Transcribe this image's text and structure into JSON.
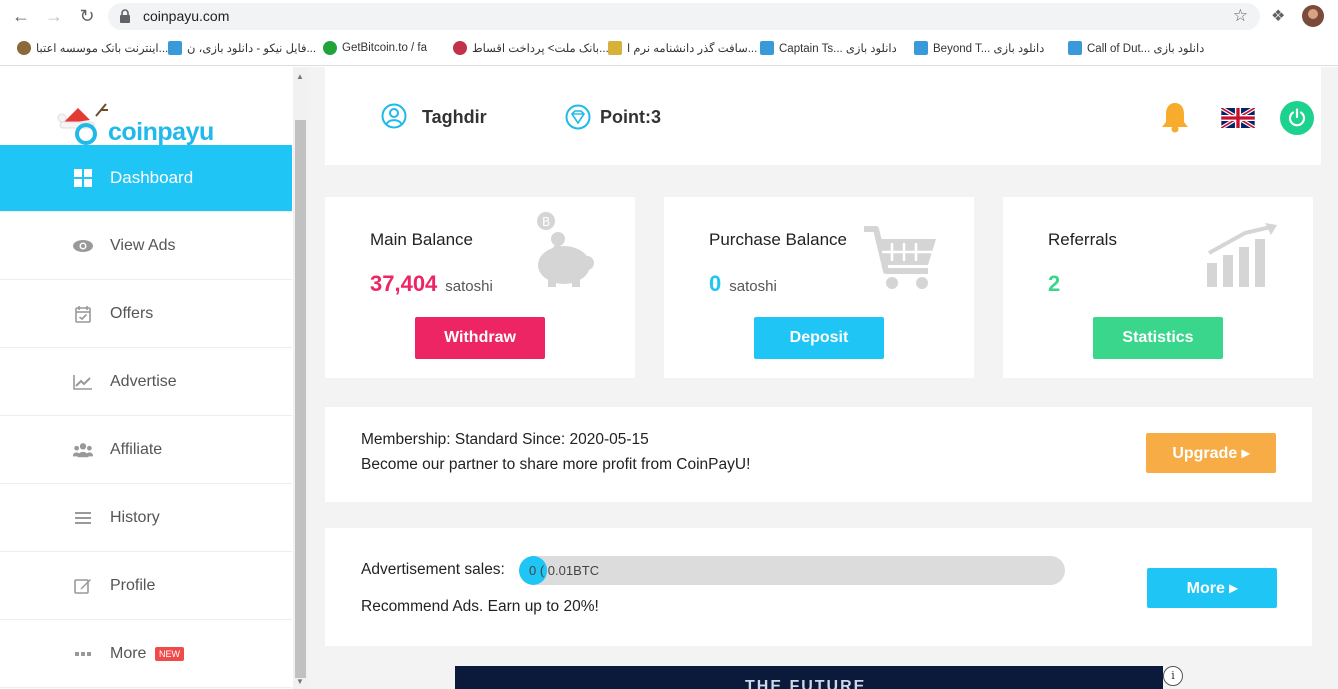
{
  "browser": {
    "url": "coinpayu.com",
    "bookmarks": [
      "اینترنت بانک موسسه اعتبا...",
      "فایل نیکو - دانلود بازی، ن...",
      "GetBitcoin.to / fa",
      "بانک ملت> پرداخت اقساط...",
      "سافت گذر دانشنامه نرم ا...",
      "Captain Ts... دانلود بازی",
      "Beyond T... دانلود بازی",
      "Call of Dut... دانلود بازی"
    ]
  },
  "sidebar": {
    "logo_text": "coinpayu",
    "items": [
      {
        "label": "Dashboard",
        "icon": "dashboard-icon"
      },
      {
        "label": "View Ads",
        "icon": "eye-icon"
      },
      {
        "label": "Offers",
        "icon": "calendar-check-icon"
      },
      {
        "label": "Advertise",
        "icon": "chart-line-icon"
      },
      {
        "label": "Affiliate",
        "icon": "users-icon"
      },
      {
        "label": "History",
        "icon": "list-icon"
      },
      {
        "label": "Profile",
        "icon": "edit-icon"
      },
      {
        "label": "More",
        "icon": "dots-icon",
        "badge": "NEW"
      }
    ]
  },
  "topbar": {
    "username": "Taghdir",
    "points": "Point:3"
  },
  "cards": {
    "main_balance": {
      "title": "Main Balance",
      "value": "37,404",
      "unit": "satoshi",
      "button": "Withdraw",
      "color": "#ee2564"
    },
    "purchase_balance": {
      "title": "Purchase Balance",
      "value": "0",
      "unit": "satoshi",
      "button": "Deposit",
      "color": "#1fc5f5"
    },
    "referrals": {
      "title": "Referrals",
      "value": "2",
      "button": "Statistics",
      "color": "#3ad68c"
    }
  },
  "membership": {
    "line1": "Membership: Standard Since: 2020-05-15",
    "line2": "Become our partner to share more profit from CoinPayU!",
    "button": "Upgrade ▸"
  },
  "ad_sales": {
    "label": "Advertisement sales:",
    "progress_text": "0 ( 0.01BTC",
    "progress_fraction": 0.05,
    "recommend": "Recommend Ads. Earn up to 20%!",
    "button": "More ▸"
  },
  "banner": {
    "text": "THE FUTURE",
    "info": "i"
  }
}
